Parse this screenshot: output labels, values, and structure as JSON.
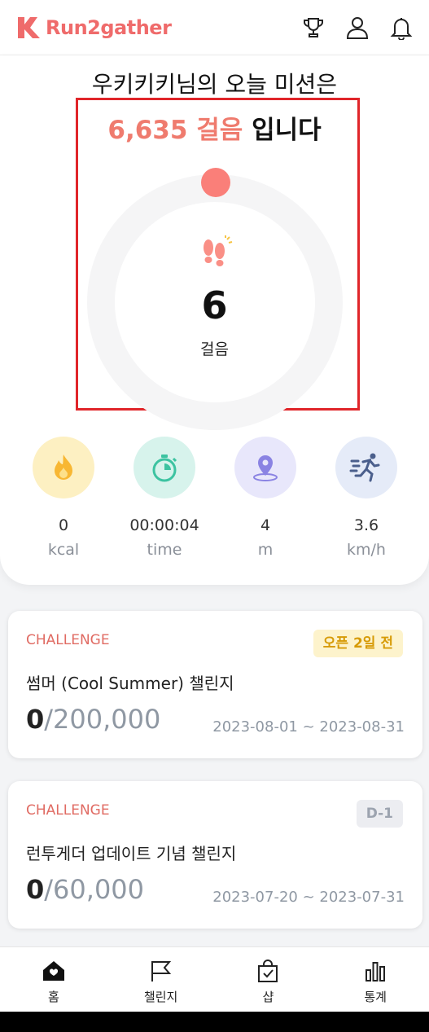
{
  "header": {
    "logo_text": "Run2gather",
    "icons": [
      "trophy-icon",
      "profile-icon",
      "bell-icon"
    ]
  },
  "mission": {
    "title": "우키키키님의 오늘 미션은",
    "goal_number": "6,635 걸음",
    "goal_suffix": "입니다",
    "current_steps": "6",
    "steps_unit": "걸음"
  },
  "stats": [
    {
      "icon": "flame-icon",
      "value": "0",
      "unit": "kcal",
      "color": "#fdf0c2"
    },
    {
      "icon": "stopwatch-icon",
      "value": "00:00:04",
      "unit": "time",
      "color": "#d7f3ec"
    },
    {
      "icon": "location-pin-icon",
      "value": "4",
      "unit": "m",
      "color": "#e8e7fb"
    },
    {
      "icon": "runner-icon",
      "value": "3.6",
      "unit": "km/h",
      "color": "#e5ebf8"
    }
  ],
  "challenges": [
    {
      "tag": "CHALLENGE",
      "badge": "오픈 2일 전",
      "name": "썸머 (Cool Summer) 챌린지",
      "current": "0",
      "goal": "/200,000",
      "dates": "2023-08-01 ~ 2023-08-31"
    },
    {
      "tag": "CHALLENGE",
      "badge": "D-1",
      "name": "런투게더 업데이트 기념 챌린지",
      "current": "0",
      "goal": "/60,000",
      "dates": "2023-07-20 ~ 2023-07-31"
    }
  ],
  "nav": [
    {
      "label": "홈",
      "icon": "home-icon"
    },
    {
      "label": "챌린지",
      "icon": "flag-icon"
    },
    {
      "label": "샵",
      "icon": "shopping-bag-icon"
    },
    {
      "label": "통계",
      "icon": "bar-chart-icon"
    }
  ],
  "colors": {
    "brand": "#ef6b6b",
    "ring_dot": "#fa7f79",
    "highlight_box": "#e0252a"
  }
}
